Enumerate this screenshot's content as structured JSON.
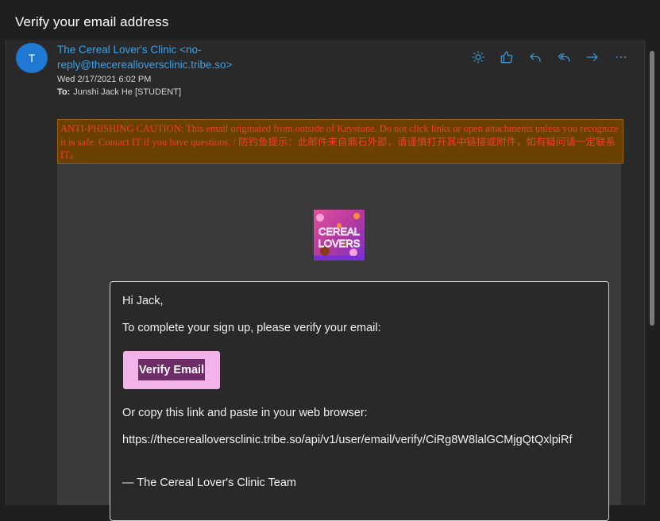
{
  "window": {
    "title": "Verify your email address"
  },
  "message": {
    "avatar_initial": "T",
    "sender": "The Cereal Lover's Clinic <no-reply@thecerealloversclinic.tribe.so>",
    "date": "Wed 2/17/2021 6:02 PM",
    "to_label": "To:",
    "to_value": "Junshi Jack He [STUDENT]"
  },
  "actions": [
    {
      "name": "brightness-button",
      "icon": "sun-icon"
    },
    {
      "name": "like-button",
      "icon": "thumbs-up-icon"
    },
    {
      "name": "reply-button",
      "icon": "reply-icon"
    },
    {
      "name": "reply-all-button",
      "icon": "reply-all-icon"
    },
    {
      "name": "forward-button",
      "icon": "forward-arrow-icon"
    },
    {
      "name": "more-actions-button",
      "icon": "ellipsis-icon"
    }
  ],
  "caution": {
    "text": "ANTI-PHISHING CAUTION: This email originated from outside of Keystone. Do not click links or open attachments unless you recognize it is safe. Contact IT if you have questions. / 防钓鱼提示：此邮件来自鼎石外部，请谨慎打开其中链接或附件，如有疑问请一定联系IT。"
  },
  "logo": {
    "line1": "CEREAL",
    "line2": "LOVERS"
  },
  "email": {
    "greeting": "Hi Jack,",
    "instruction": "To complete your sign up, please verify your email:",
    "button_label": "Verify Email",
    "copy_text": "Or copy this link and paste in your web browser:",
    "link": "https://thecerealloversclinic.tribe.so/api/v1/user/email/verify/CiRg8W8lalGCMjgQtQxlpiRf",
    "signature": "— The Cereal Lover's Clinic Team"
  },
  "colors": {
    "accent": "#3aa0e8",
    "avatar": "#1f79d3",
    "caution_bg": "#6a4000",
    "caution_text": "#f23c2c",
    "button_outer": "#f2b3e8",
    "button_inner": "#6e2c69"
  }
}
